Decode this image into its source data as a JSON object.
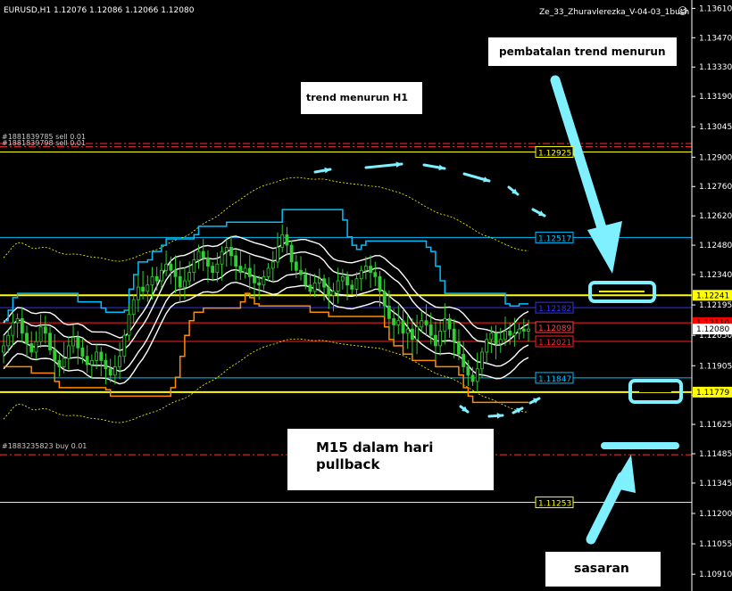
{
  "header": {
    "symbol_info": "EURUSD,H1  1.12076 1.12086 1.12066 1.12080",
    "expert_name": "Ze_33_Zhuravlerezka_V-04-03_1bush",
    "smiley": "☺"
  },
  "orders": [
    {
      "label": "#1881839785 sell 0.01",
      "price": 1.12965
    },
    {
      "label": "#1881839798 sell 0.01",
      "price": 1.1295
    },
    {
      "label": "#1883235823 buy 0.01",
      "price": 1.1148
    }
  ],
  "annotations": {
    "cancel_trend": "pembatalan trend menurun",
    "trend_h1": "trend menurun H1",
    "m15_line1": "M15 dalam hari",
    "m15_line2": "pullback",
    "target": "sasaran"
  },
  "colors": {
    "background": "#000000",
    "candle": "#32cd32",
    "level_yellow": "#ffff00",
    "level_cyan": "#00bfff",
    "level_blue": "#3030ff",
    "level_red": "#ff2020",
    "level_orange": "#ff8c00",
    "arrow_cyan": "#7ff0ff",
    "current_price_bg": "#ff0000"
  },
  "chart_data": {
    "type": "candlestick",
    "symbol": "EURUSD",
    "timeframe": "H1",
    "ohlc_last": {
      "open": 1.12076,
      "high": 1.12086,
      "low": 1.12066,
      "close": 1.1208
    },
    "ylim": [
      1.1083,
      1.1365
    ],
    "y_ticks": [
      "1.13610",
      "1.13470",
      "1.13330",
      "1.13190",
      "1.13045",
      "1.12900",
      "1.12760",
      "1.12620",
      "1.12480",
      "1.12340",
      "1.12195",
      "1.12050",
      "1.11905",
      "1.11765",
      "1.11625",
      "1.11485",
      "1.11345",
      "1.11200",
      "1.11055",
      "1.10910"
    ],
    "price_labels": [
      {
        "text": "1.12925",
        "price": 1.12925,
        "color": "#ffff00",
        "style": "box"
      },
      {
        "text": "1.12517",
        "price": 1.12517,
        "color": "#00bfff",
        "style": "box"
      },
      {
        "text": "1.12182",
        "price": 1.12182,
        "color": "#3030ff",
        "style": "box"
      },
      {
        "text": "1.12089",
        "price": 1.12089,
        "color": "#ff4040",
        "style": "box"
      },
      {
        "text": "1.12021",
        "price": 1.12021,
        "color": "#ff2020",
        "style": "box"
      },
      {
        "text": "1.11847",
        "price": 1.11847,
        "color": "#00bfff",
        "style": "box"
      },
      {
        "text": "1.11253",
        "price": 1.11253,
        "color": "#ffff00",
        "style": "box"
      }
    ],
    "axis_tags": [
      {
        "text": "1.12241",
        "price": 1.12241,
        "bg": "#ffff00",
        "fg": "#000000"
      },
      {
        "text": "1.11779",
        "price": 1.11779,
        "bg": "#ffff00",
        "fg": "#000000"
      },
      {
        "text": "1.12110",
        "price": 1.1211,
        "bg": "#ff0000",
        "fg": "#000000"
      },
      {
        "text": "1.12080",
        "price": 1.1208,
        "bg": "#ffffff",
        "fg": "#000000"
      }
    ],
    "levels": [
      {
        "price": 1.12925,
        "color": "#ffff00",
        "width": 1
      },
      {
        "price": 1.12517,
        "color": "#00bfff",
        "width": 1
      },
      {
        "price": 1.12241,
        "color": "#ffff00",
        "width": 2
      },
      {
        "price": 1.12182,
        "color": "#3030ff",
        "width": 1
      },
      {
        "price": 1.1211,
        "color": "#ff2020",
        "width": 1
      },
      {
        "price": 1.12021,
        "color": "#ff2020",
        "width": 1
      },
      {
        "price": 1.11847,
        "color": "#00bfff",
        "width": 1
      },
      {
        "price": 1.11779,
        "color": "#ffff00",
        "width": 2
      },
      {
        "price": 1.11253,
        "color": "#ffff00",
        "width": 1
      }
    ],
    "close_path": [
      1.12,
      1.1205,
      1.1211,
      1.1213,
      1.1206,
      1.1201,
      1.1197,
      1.1202,
      1.1209,
      1.1206,
      1.1198,
      1.1193,
      1.119,
      1.1194,
      1.12,
      1.1204,
      1.1199,
      1.1195,
      1.1191,
      1.1193,
      1.1197,
      1.1193,
      1.1189,
      1.1186,
      1.119,
      1.1195,
      1.1205,
      1.1215,
      1.1222,
      1.1228,
      1.1226,
      1.1229,
      1.1233,
      1.1231,
      1.1236,
      1.1239,
      1.1236,
      1.1233,
      1.1228,
      1.1231,
      1.1235,
      1.1241,
      1.1245,
      1.1242,
      1.1238,
      1.1235,
      1.1239,
      1.1245,
      1.1247,
      1.1243,
      1.1238,
      1.1235,
      1.1237,
      1.1233,
      1.123,
      1.1229,
      1.1233,
      1.1237,
      1.124,
      1.1247,
      1.1253,
      1.1248,
      1.124,
      1.1236,
      1.1234,
      1.1229,
      1.1226,
      1.123,
      1.1232,
      1.1228,
      1.1224,
      1.1226,
      1.1231,
      1.1233,
      1.1229,
      1.1227,
      1.1232,
      1.1236,
      1.1238,
      1.1235,
      1.1233,
      1.1226,
      1.1219,
      1.1213,
      1.121,
      1.1212,
      1.1206,
      1.1208,
      1.1203,
      1.1209,
      1.1212,
      1.121,
      1.1205,
      1.12,
      1.1207,
      1.1213,
      1.1208,
      1.1202,
      1.1196,
      1.119,
      1.1186,
      1.1183,
      1.1189,
      1.1197,
      1.1203,
      1.1206,
      1.1201,
      1.1203,
      1.1207,
      1.1205,
      1.1206,
      1.1208,
      1.1207,
      1.1208
    ]
  }
}
